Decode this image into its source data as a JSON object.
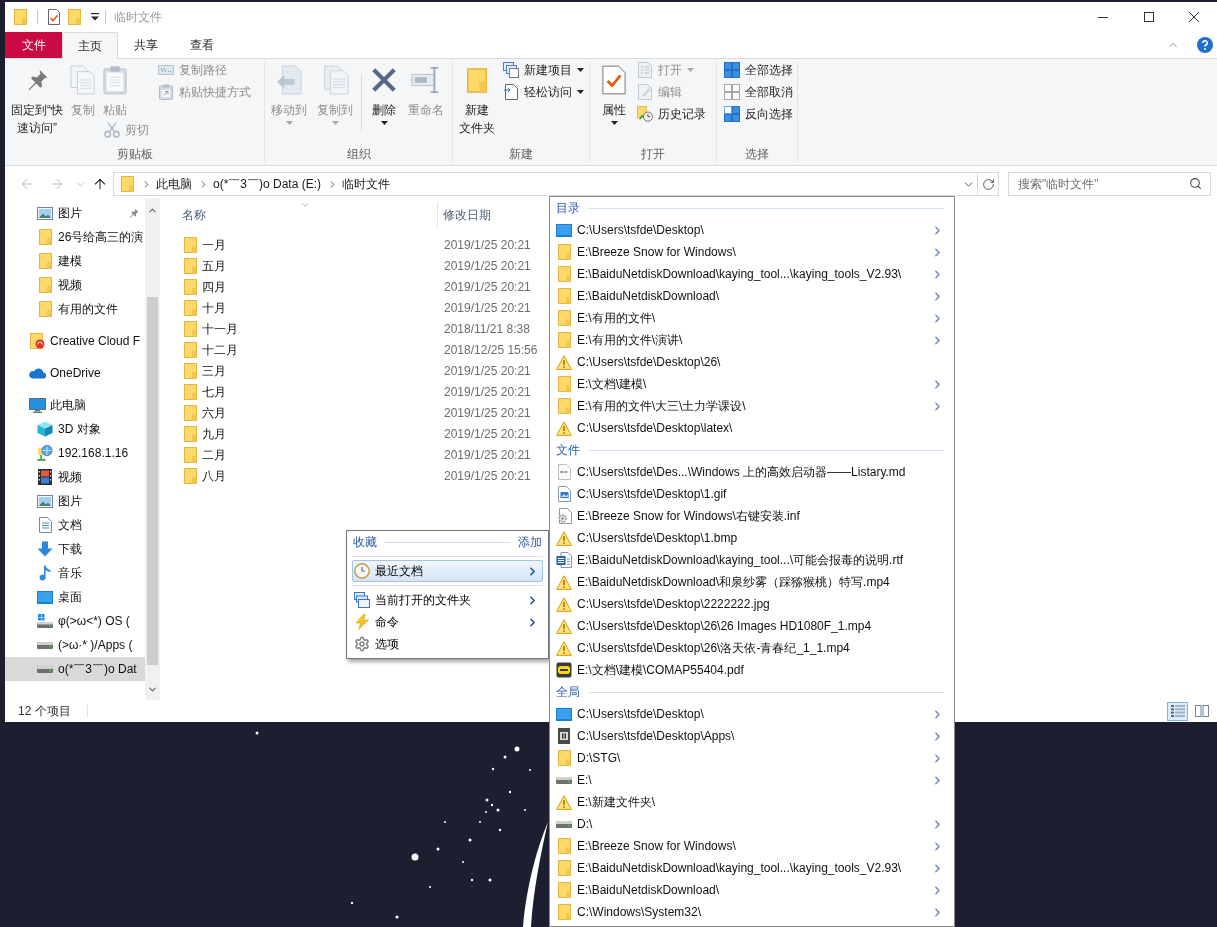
{
  "title_bar": {
    "title": "临时文件"
  },
  "ribbon": {
    "tabs": [
      {
        "label": "文件",
        "kind": "file",
        "selected": false
      },
      {
        "label": "主页",
        "kind": "tab",
        "selected": true
      },
      {
        "label": "共享",
        "kind": "tab",
        "selected": false
      },
      {
        "label": "查看",
        "kind": "tab",
        "selected": false
      }
    ],
    "groups": [
      {
        "label": "剪贴板",
        "sections": [
          [
            [
              {
                "kind": "pin",
                "lines": [
                  "固定到“快",
                  "速访问”"
                ],
                "disabled": false,
                "dropdown": false
              }
            ],
            [
              {
                "kind": "copy",
                "lines": [
                  "复制"
                ],
                "disabled": true,
                "dropdown": false
              }
            ],
            [
              {
                "kind": "paste",
                "lines": [
                  "粘贴"
                ],
                "disabled": true,
                "dropdown": false
              },
              {
                "kind": "cut",
                "label": "剪切",
                "disabled": true,
                "dropdown": false
              }
            ],
            [
              {
                "kind": "copy_path",
                "label": "复制路径",
                "disabled": true,
                "dropdown": false
              },
              {
                "kind": "paste_shortcut",
                "label": "粘贴快捷方式",
                "disabled": true,
                "dropdown": false
              }
            ]
          ]
        ]
      },
      {
        "label": "组织",
        "sections": [
          [
            [
              {
                "kind": "move_to",
                "lines": [
                  "移动到"
                ],
                "disabled": true,
                "dropdown": true
              }
            ],
            [
              {
                "kind": "copy_to",
                "lines": [
                  "复制到"
                ],
                "disabled": true,
                "dropdown": true
              }
            ]
          ],
          [
            [
              {
                "kind": "delete",
                "lines": [
                  "删除"
                ],
                "disabled": false,
                "dropdown": true
              }
            ],
            [
              {
                "kind": "rename",
                "lines": [
                  "重命名"
                ],
                "disabled": true,
                "dropdown": false
              }
            ]
          ]
        ]
      },
      {
        "label": "新建",
        "sections": [
          [
            [
              {
                "kind": "new_folder",
                "lines": [
                  "新建",
                  "文件夹"
                ],
                "disabled": false,
                "dropdown": false
              }
            ],
            [
              {
                "kind": "new_item",
                "label": "新建项目",
                "disabled": false,
                "dropdown": true
              },
              {
                "kind": "easy_access",
                "label": "轻松访问",
                "disabled": false,
                "dropdown": true
              }
            ]
          ]
        ]
      },
      {
        "label": "打开",
        "sections": [
          [
            [
              {
                "kind": "properties",
                "lines": [
                  "属性"
                ],
                "disabled": false,
                "dropdown": true
              }
            ],
            [
              {
                "kind": "open",
                "label": "打开",
                "disabled": true,
                "dropdown": true
              },
              {
                "kind": "edit",
                "label": "编辑",
                "disabled": true,
                "dropdown": false
              },
              {
                "kind": "history",
                "label": "历史记录",
                "disabled": false,
                "dropdown": false
              }
            ]
          ]
        ]
      },
      {
        "label": "选择",
        "sections": [
          [
            [
              {
                "kind": "select_all",
                "label": "全部选择",
                "disabled": false,
                "dropdown": false
              },
              {
                "kind": "select_none",
                "label": "全部取消",
                "disabled": false,
                "dropdown": false
              },
              {
                "kind": "invert_selection",
                "label": "反向选择",
                "disabled": false,
                "dropdown": false
              }
            ]
          ]
        ]
      }
    ]
  },
  "address_bar": {
    "nav_buttons": [
      {
        "kind": "back",
        "disabled": true
      },
      {
        "kind": "forward",
        "disabled": true
      },
      {
        "kind": "recent",
        "disabled": true
      },
      {
        "kind": "up",
        "disabled": false
      }
    ],
    "breadcrumbs": [
      "此电脑",
      "o(*￣3￣)o Data (E:)",
      "临时文件"
    ]
  },
  "search": {
    "placeholder": "搜索\"临时文件\""
  },
  "navigation_pane": {
    "quick_access_items": [
      {
        "label": "图片",
        "kind": "pictures",
        "pinned": true,
        "selected": false
      },
      {
        "label": "26号给高三的演",
        "kind": "folder",
        "pinned": false,
        "selected": false
      },
      {
        "label": "建模",
        "kind": "folder",
        "pinned": false,
        "selected": false
      },
      {
        "label": "视频",
        "kind": "folder",
        "pinned": false,
        "selected": false
      },
      {
        "label": "有用的文件",
        "kind": "folder",
        "pinned": false,
        "selected": false
      }
    ],
    "items": [
      {
        "label": "Creative Cloud F",
        "kind": "creative_cloud",
        "selected": false
      },
      {
        "label": "OneDrive",
        "kind": "onedrive",
        "selected": false
      },
      {
        "label": "此电脑",
        "kind": "computer",
        "selected": false,
        "children": [
          {
            "label": "3D 对象",
            "kind": "cube",
            "selected": false
          },
          {
            "label": "192.168.1.16",
            "kind": "network",
            "selected": false
          },
          {
            "label": "视频",
            "kind": "videos",
            "selected": false
          },
          {
            "label": "图片",
            "kind": "pictures",
            "selected": false
          },
          {
            "label": "文档",
            "kind": "documents",
            "selected": false
          },
          {
            "label": "下载",
            "kind": "downloads",
            "selected": false
          },
          {
            "label": "音乐",
            "kind": "music",
            "selected": false
          },
          {
            "label": "桌面",
            "kind": "desktop",
            "selected": false
          },
          {
            "label": "φ(>ω<*) OS (",
            "kind": "os_drive",
            "selected": false
          },
          {
            "label": "(>ω·* )/Apps (",
            "kind": "drive",
            "selected": false
          },
          {
            "label": "o(*￣3￣)o Dat",
            "kind": "drive",
            "selected": true
          }
        ]
      }
    ]
  },
  "file_list": {
    "columns": [
      "名称",
      "修改日期"
    ],
    "rows": [
      {
        "name": "一月",
        "modified": "2019/1/25 20:21",
        "selected": false
      },
      {
        "name": "五月",
        "modified": "2019/1/25 20:21",
        "selected": false
      },
      {
        "name": "四月",
        "modified": "2019/1/25 20:21",
        "selected": false
      },
      {
        "name": "十月",
        "modified": "2019/1/25 20:21",
        "selected": false
      },
      {
        "name": "十一月",
        "modified": "2018/11/21 8:38",
        "selected": false
      },
      {
        "name": "十二月",
        "modified": "2018/12/25 15:56",
        "selected": false
      },
      {
        "name": "三月",
        "modified": "2019/1/25 20:21",
        "selected": false
      },
      {
        "name": "七月",
        "modified": "2019/1/25 20:21",
        "selected": false
      },
      {
        "name": "六月",
        "modified": "2019/1/25 20:21",
        "selected": false
      },
      {
        "name": "九月",
        "modified": "2019/1/25 20:21",
        "selected": false
      },
      {
        "name": "二月",
        "modified": "2019/1/25 20:21",
        "selected": false
      },
      {
        "name": "八月",
        "modified": "2019/1/25 20:21",
        "selected": false
      }
    ]
  },
  "status_bar": {
    "item_count": "12 个项目",
    "views": [
      {
        "kind": "details",
        "selected": true
      },
      {
        "kind": "large_icons",
        "selected": false
      }
    ]
  },
  "favorites_menu": {
    "title": "收藏",
    "add_link": "添加",
    "groups": [
      {
        "items": [
          {
            "label": "最近文档",
            "kind": "clock",
            "selected": true,
            "submenu": true
          }
        ]
      },
      {
        "items": [
          {
            "label": "当前打开的文件夹",
            "kind": "windows",
            "selected": false,
            "submenu": true
          },
          {
            "label": "命令",
            "kind": "lightning",
            "selected": false,
            "submenu": true
          },
          {
            "label": "选项",
            "kind": "gear",
            "selected": false,
            "submenu": false
          }
        ]
      }
    ]
  },
  "recent_menu": {
    "sections": [
      {
        "title": "目录",
        "items": [
          {
            "path": "C:\\Users\\tsfde\\Desktop\\",
            "kind": "desktop",
            "submenu": true
          },
          {
            "path": "E:\\Breeze Snow for Windows\\",
            "kind": "folder",
            "submenu": true
          },
          {
            "path": "E:\\BaiduNetdiskDownload\\kaying_tool...\\kaying_tools_V2.93\\",
            "kind": "folder",
            "submenu": true
          },
          {
            "path": "E:\\BaiduNetdiskDownload\\",
            "kind": "folder",
            "submenu": true
          },
          {
            "path": "E:\\有用的文件\\",
            "kind": "folder",
            "submenu": true
          },
          {
            "path": "E:\\有用的文件\\演讲\\",
            "kind": "folder",
            "submenu": true
          },
          {
            "path": "C:\\Users\\tsfde\\Desktop\\26\\",
            "kind": "warning",
            "submenu": false
          },
          {
            "path": "E:\\文档\\建模\\",
            "kind": "folder",
            "submenu": true
          },
          {
            "path": "E:\\有用的文件\\大三\\土力学课设\\",
            "kind": "folder",
            "submenu": true
          },
          {
            "path": "C:\\Users\\tsfde\\Desktop\\latex\\",
            "kind": "warning",
            "submenu": false
          }
        ]
      },
      {
        "title": "文件",
        "items": [
          {
            "path": "C:\\Users\\tsfde\\Des...\\Windows 上的高效启动器——Listary.md",
            "kind": "markdown",
            "submenu": false
          },
          {
            "path": "C:\\Users\\tsfde\\Desktop\\1.gif",
            "kind": "image",
            "submenu": false
          },
          {
            "path": "E:\\Breeze Snow for Windows\\右键安装.inf",
            "kind": "settings_file",
            "submenu": false
          },
          {
            "path": "C:\\Users\\tsfde\\Desktop\\1.bmp",
            "kind": "warning",
            "submenu": false
          },
          {
            "path": "E:\\BaiduNetdiskDownload\\kaying_tool...\\可能会报毒的说明.rtf",
            "kind": "word",
            "submenu": false
          },
          {
            "path": "E:\\BaiduNetdiskDownload\\和泉纱雾（踩猕猴桃）特写.mp4",
            "kind": "warning",
            "submenu": false
          },
          {
            "path": "C:\\Users\\tsfde\\Desktop\\2222222.jpg",
            "kind": "warning",
            "submenu": false
          },
          {
            "path": "C:\\Users\\tsfde\\Desktop\\26\\26 Images HD1080F_1.mp4",
            "kind": "warning",
            "submenu": false
          },
          {
            "path": "C:\\Users\\tsfde\\Desktop\\26\\洛天依-青春纪_1_1.mp4",
            "kind": "warning",
            "submenu": false
          },
          {
            "path": "E:\\文档\\建模\\COMAP55404.pdf",
            "kind": "pdf",
            "submenu": false
          }
        ]
      },
      {
        "title": "全局",
        "items": [
          {
            "path": "C:\\Users\\tsfde\\Desktop\\",
            "kind": "desktop",
            "submenu": true
          },
          {
            "path": "C:\\Users\\tsfde\\Desktop\\Apps\\",
            "kind": "app",
            "submenu": true
          },
          {
            "path": "D:\\STG\\",
            "kind": "folder",
            "submenu": true
          },
          {
            "path": "E:\\",
            "kind": "drive",
            "submenu": true
          },
          {
            "path": "E:\\新建文件夹\\",
            "kind": "warning",
            "submenu": false
          },
          {
            "path": "D:\\",
            "kind": "drive",
            "submenu": true
          },
          {
            "path": "E:\\Breeze Snow for Windows\\",
            "kind": "folder",
            "submenu": true
          },
          {
            "path": "E:\\BaiduNetdiskDownload\\kaying_tool...\\kaying_tools_V2.93\\",
            "kind": "folder",
            "submenu": true
          },
          {
            "path": "E:\\BaiduNetdiskDownload\\",
            "kind": "folder",
            "submenu": true
          },
          {
            "path": "C:\\Windows\\System32\\",
            "kind": "folder",
            "submenu": true
          }
        ]
      }
    ]
  }
}
